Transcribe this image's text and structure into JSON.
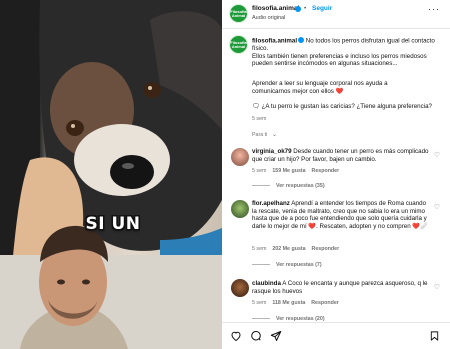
{
  "video": {
    "caption": "SI UN"
  },
  "header": {
    "avatar_text": "Filosofia Animal",
    "username": "filosofia.animal",
    "separator": "•",
    "follow_label": "Seguir",
    "subtitle": "Audio original",
    "more_label": "···"
  },
  "post": {
    "username": "filosofia.animal",
    "text_line1": "No todos los perros disfrutan igual del contacto físico.",
    "text_line2": "Ellos también tienen preferencias e incluso los perros miedosos pueden sentirse incómodos en algunas situaciones...",
    "text_line3": "Aprender a leer su lenguaje corporal nos ayuda a comunicarnos mejor con ellos",
    "text_line4": "¿A tu perro le gustan las caricias? ¿Tiene alguna preferencia?",
    "emoji1": "❤️",
    "emoji2": "🗨",
    "time": "5 sem"
  },
  "translate_label": "Para ti",
  "comments": [
    {
      "username": "virginia_ok79",
      "text": "Desde cuando tener un perro es más complicado que criar un hijo? Por favor, bajen un cambio.",
      "time": "5 sem",
      "likes": "159 Me gusta",
      "reply": "Responder",
      "replies": "Ver respuestas (35)"
    },
    {
      "username": "flor.apelhanz",
      "text": "Aprendí a entender los tiempos de Roma cuando la rescate, venia de maltrato, creo que no sabia lo era un mimo hasta que de a poco fue entendiendo que solo quería cuidarla y darle lo mejor de mí ❤️. Rescaten, adopten y no compren ❤️🩹",
      "time": "5 sem",
      "likes": "202 Me gusta",
      "reply": "Responder",
      "replies": "Ver respuestas (7)"
    },
    {
      "username": "claubinda",
      "text": "A Coco le encanta y aunque parezca asqueroso, q le rasque los huevos",
      "time": "5 sem",
      "likes": "118 Me gusta",
      "reply": "Responder",
      "replies": "Ver respuestas (20)"
    }
  ],
  "icons": [
    "heart-icon",
    "comment-icon",
    "share-icon",
    "save-icon"
  ],
  "colors": {
    "accent": "#0095f6",
    "brand": "#1f9a3a",
    "heart": "#e0243a"
  }
}
